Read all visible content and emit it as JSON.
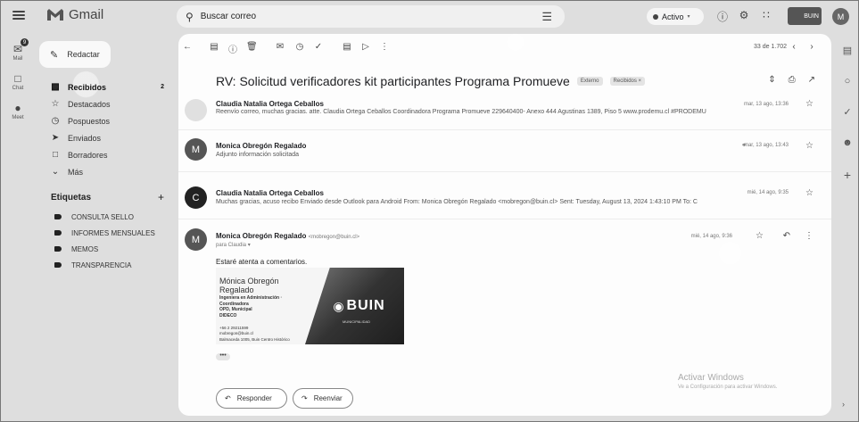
{
  "app": {
    "name": "Gmail"
  },
  "search": {
    "placeholder": "Buscar correo"
  },
  "status": {
    "label": "Activo"
  },
  "account": {
    "badge": "BUIN",
    "initial": "M"
  },
  "rail": [
    {
      "label": "Mail",
      "badge": "9"
    },
    {
      "label": "Chat"
    },
    {
      "label": "Meet"
    }
  ],
  "compose": {
    "label": "Redactar"
  },
  "nav": [
    {
      "label": "Recibidos",
      "count": "2",
      "active": true
    },
    {
      "label": "Destacados"
    },
    {
      "label": "Pospuestos"
    },
    {
      "label": "Enviados"
    },
    {
      "label": "Borradores"
    },
    {
      "label": "Más"
    }
  ],
  "labels": {
    "heading": "Etiquetas",
    "items": [
      "CONSULTA SELLO",
      "INFORMES MENSUALES",
      "MEMOS",
      "TRANSPARENCIA"
    ]
  },
  "toolbar": {
    "pager": "33 de 1.702"
  },
  "thread": {
    "subject": "RV: Solicitud verificadores kit participantes Programa Promueve",
    "chips": [
      "Externo",
      "Recibidos ×"
    ]
  },
  "messages": [
    {
      "sender": "Claudia Natalia Ortega Ceballos",
      "snippet": "Reenvío correo, muchas gracias. atte. Claudia Ortega Ceballos Coordinadora Programa Promueve 229640400- Anexo 444 Agustinas 1389, Piso 5 www.prodemu.cl #PRODEMU",
      "date": "mar, 13 ago, 13:36"
    },
    {
      "sender": "Monica Obregón Regalado",
      "snippet": "Adjunto información solicitada",
      "date": "mar, 13 ago, 13:43",
      "initial": "M"
    },
    {
      "sender": "Claudia Natalia Ortega Ceballos",
      "snippet": "Muchas gracias, acuso recibo Enviado desde Outlook para Android From: Monica Obregón Regalado <mobregon@buin.cl> Sent: Tuesday, August 13, 2024 1:43:10 PM To: C",
      "date": "mié, 14 ago, 9:35",
      "initial": "C"
    },
    {
      "sender": "Monica Obregón Regalado",
      "email": "<mobregon@buin.cl>",
      "to": "para Claudia",
      "date": "mié, 14 ago, 9:36",
      "initial": "M",
      "body": "Estaré atenta a comentarios."
    }
  ],
  "signature": {
    "name": "Mónica Obregón Regalado",
    "role1": "Ingeniera en Administración · Coordinadora",
    "role2": "OPD, Municipal",
    "role3": "DIDECO",
    "contact1": "+56 2 29211599",
    "contact2": "mobregon@buin.cl",
    "contact3": "Balmaceda 1005, Buin Centro Histórico",
    "logo": "BUIN",
    "logo_sub": "MUNICIPALIDAD"
  },
  "actions": {
    "reply": "Responder",
    "forward": "Reenviar"
  },
  "watermark": {
    "line1": "Activar Windows",
    "line2": "Ve a Configuración para activar Windows."
  }
}
